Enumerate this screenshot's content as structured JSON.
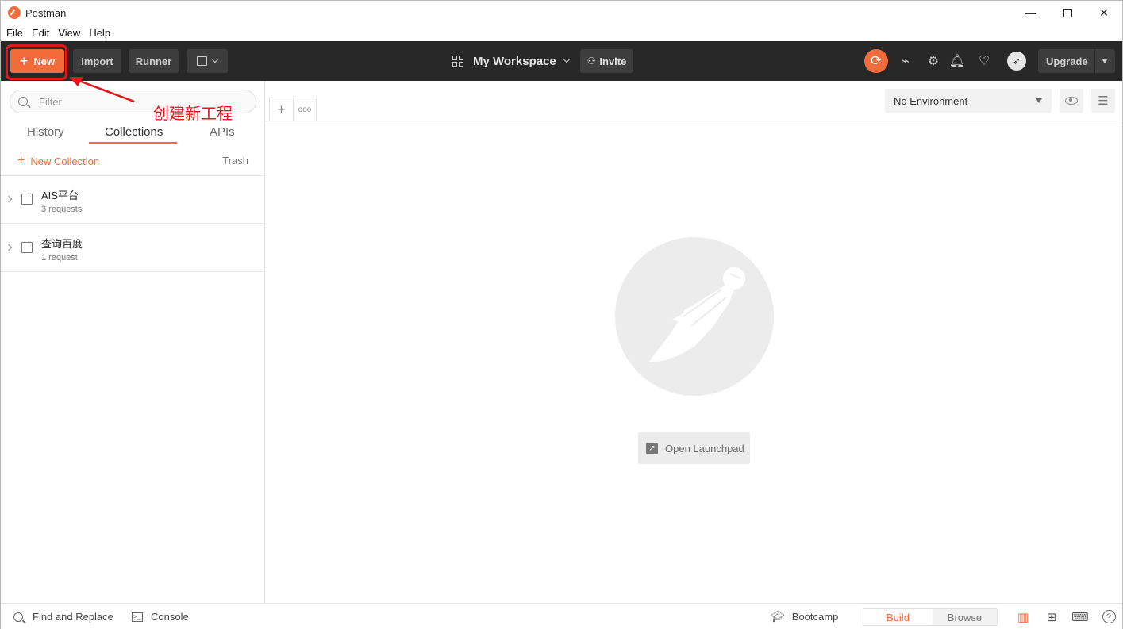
{
  "window": {
    "title": "Postman",
    "controls": [
      "—",
      "✕"
    ]
  },
  "menu": [
    "File",
    "Edit",
    "View",
    "Help"
  ],
  "header": {
    "new_label": "New",
    "import_label": "Import",
    "runner_label": "Runner",
    "workspace_label": "My Workspace",
    "invite_label": "Invite",
    "upgrade_label": "Upgrade"
  },
  "sidebar": {
    "filter_placeholder": "Filter",
    "tabs": [
      "History",
      "Collections",
      "APIs"
    ],
    "active_tab": "Collections",
    "new_collection_label": "New Collection",
    "trash_label": "Trash",
    "collections": [
      {
        "name": "AIS平台",
        "count": "3 requests"
      },
      {
        "name": "查询百度",
        "count": "1 request"
      }
    ]
  },
  "main": {
    "environment": "No Environment",
    "launchpad_label": "Open Launchpad"
  },
  "annotation": {
    "text": "创建新工程",
    "color": "#e1171d"
  },
  "footer": {
    "find_replace_label": "Find and Replace",
    "console_label": "Console",
    "bootcamp_label": "Bootcamp",
    "build_label": "Build",
    "browse_label": "Browse"
  },
  "colors": {
    "accent": "#f26b3a",
    "header_bg": "#282828"
  },
  "icons": {
    "header": [
      "sync-icon",
      "satellite-icon",
      "gear-icon",
      "bell-icon",
      "heart-icon",
      "rocket-icon"
    ],
    "footer": [
      "two-pane-icon",
      "split-icon",
      "keyboard-icon",
      "help-icon"
    ]
  }
}
